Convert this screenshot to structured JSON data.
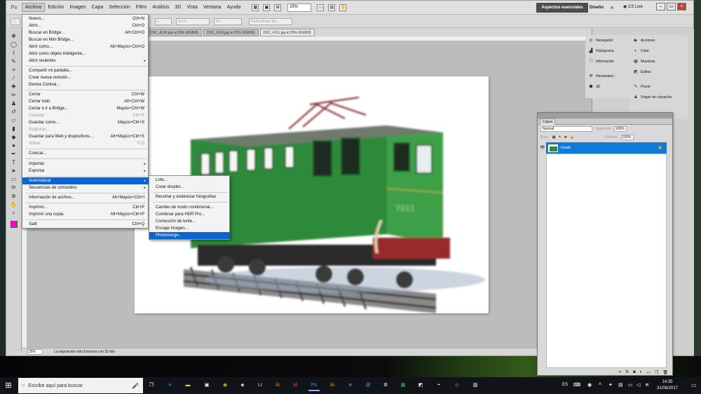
{
  "app": {
    "logo": "Ps",
    "menus": [
      "Archivo",
      "Edición",
      "Imagen",
      "Capa",
      "Selección",
      "Filtro",
      "Análisis",
      "3D",
      "Vista",
      "Ventana",
      "Ayuda"
    ],
    "zoom": "25%",
    "workspace": "Aspectos esenciales",
    "design": "Diseño",
    "chevron": "»",
    "cslive": "CS Live",
    "win_min": "–",
    "win_max": "▭",
    "win_close": "×"
  },
  "options_bar": {
    "width_label": "Anch.:",
    "height_label": "Alt.:",
    "refine_button": "Perfeccionar bor..."
  },
  "doc_tabs": [
    "DSC_4109.jpg al 25% (RGB/8)",
    "DSC_4110.jpg al 25% (RGB/8)",
    "DSC_4111.jpg al 25% (RGB/8)"
  ],
  "status": {
    "zoom": "25%",
    "message": "La exposición sólo funciona con 32 bits"
  },
  "archivo_menu": [
    {
      "label": "Nuevo...",
      "shortcut": "Ctrl+N"
    },
    {
      "label": "Abrir...",
      "shortcut": "Ctrl+O"
    },
    {
      "label": "Buscar en Bridge...",
      "shortcut": "Alt+Ctrl+O"
    },
    {
      "label": "Buscar en Mini Bridge...",
      "shortcut": ""
    },
    {
      "label": "Abrir como...",
      "shortcut": "Alt+Mayús+Ctrl+O"
    },
    {
      "label": "Abrir como objeto inteligente...",
      "shortcut": ""
    },
    {
      "label": "Abrir recientes",
      "shortcut": ""
    },
    {
      "label": "Compartir mi pantalla...",
      "shortcut": ""
    },
    {
      "label": "Crear nueva revisión...",
      "shortcut": ""
    },
    {
      "label": "Device Central...",
      "shortcut": ""
    },
    {
      "label": "Cerrar",
      "shortcut": "Ctrl+W"
    },
    {
      "label": "Cerrar todo",
      "shortcut": "Alt+Ctrl+W"
    },
    {
      "label": "Cerrar e ir a Bridge...",
      "shortcut": "Mayús+Ctrl+W"
    },
    {
      "label": "Guardar",
      "shortcut": "Ctrl+S"
    },
    {
      "label": "Guardar como...",
      "shortcut": "Mayús+Ctrl+S"
    },
    {
      "label": "Registrar...",
      "shortcut": ""
    },
    {
      "label": "Guardar para Web y dispositivos...",
      "shortcut": "Alt+Mayús+Ctrl+S"
    },
    {
      "label": "Volver",
      "shortcut": "F12"
    },
    {
      "label": "Colocar...",
      "shortcut": ""
    },
    {
      "label": "Importar",
      "shortcut": ""
    },
    {
      "label": "Exportar",
      "shortcut": ""
    },
    {
      "label": "Automatizar",
      "shortcut": ""
    },
    {
      "label": "Secuencias de comandos",
      "shortcut": ""
    },
    {
      "label": "Información de archivo...",
      "shortcut": "Alt+Mayús+Ctrl+I"
    },
    {
      "label": "Imprimir...",
      "shortcut": "Ctrl+P"
    },
    {
      "label": "Imprimir una copia",
      "shortcut": "Alt+Mayús+Ctrl+P"
    },
    {
      "label": "Salir",
      "shortcut": "Ctrl+Q"
    }
  ],
  "automatizar_menu": [
    "Lote...",
    "Crear droplet...",
    "Recortar y enderezar fotografías",
    "Cambio de modo condicional...",
    "Combinar para HDR Pro...",
    "Corrección de lente...",
    "Encajar imagen...",
    "Photomerge..."
  ],
  "panels": {
    "col1": [
      "Navegador",
      "Histograma",
      "Información",
      "Herramient...",
      "3D"
    ],
    "col2": [
      "Acciones",
      "Color",
      "Muestras",
      "Estilos",
      "Pincel",
      "Origen de clonación"
    ]
  },
  "layers": {
    "tab": "Capas",
    "blend_mode": "Normal",
    "opacity_label": "Opacidad:",
    "opacity": "100%",
    "lock_label": "Bloq.:",
    "fill_label": "Relleno:",
    "fill": "100%",
    "layer_name": "Fondo",
    "footer_fx": "fx"
  },
  "taskbar": {
    "search_placeholder": "Escribe aquí para buscar",
    "lang": "ES",
    "time": "14:35",
    "date": "31/08/2017"
  }
}
